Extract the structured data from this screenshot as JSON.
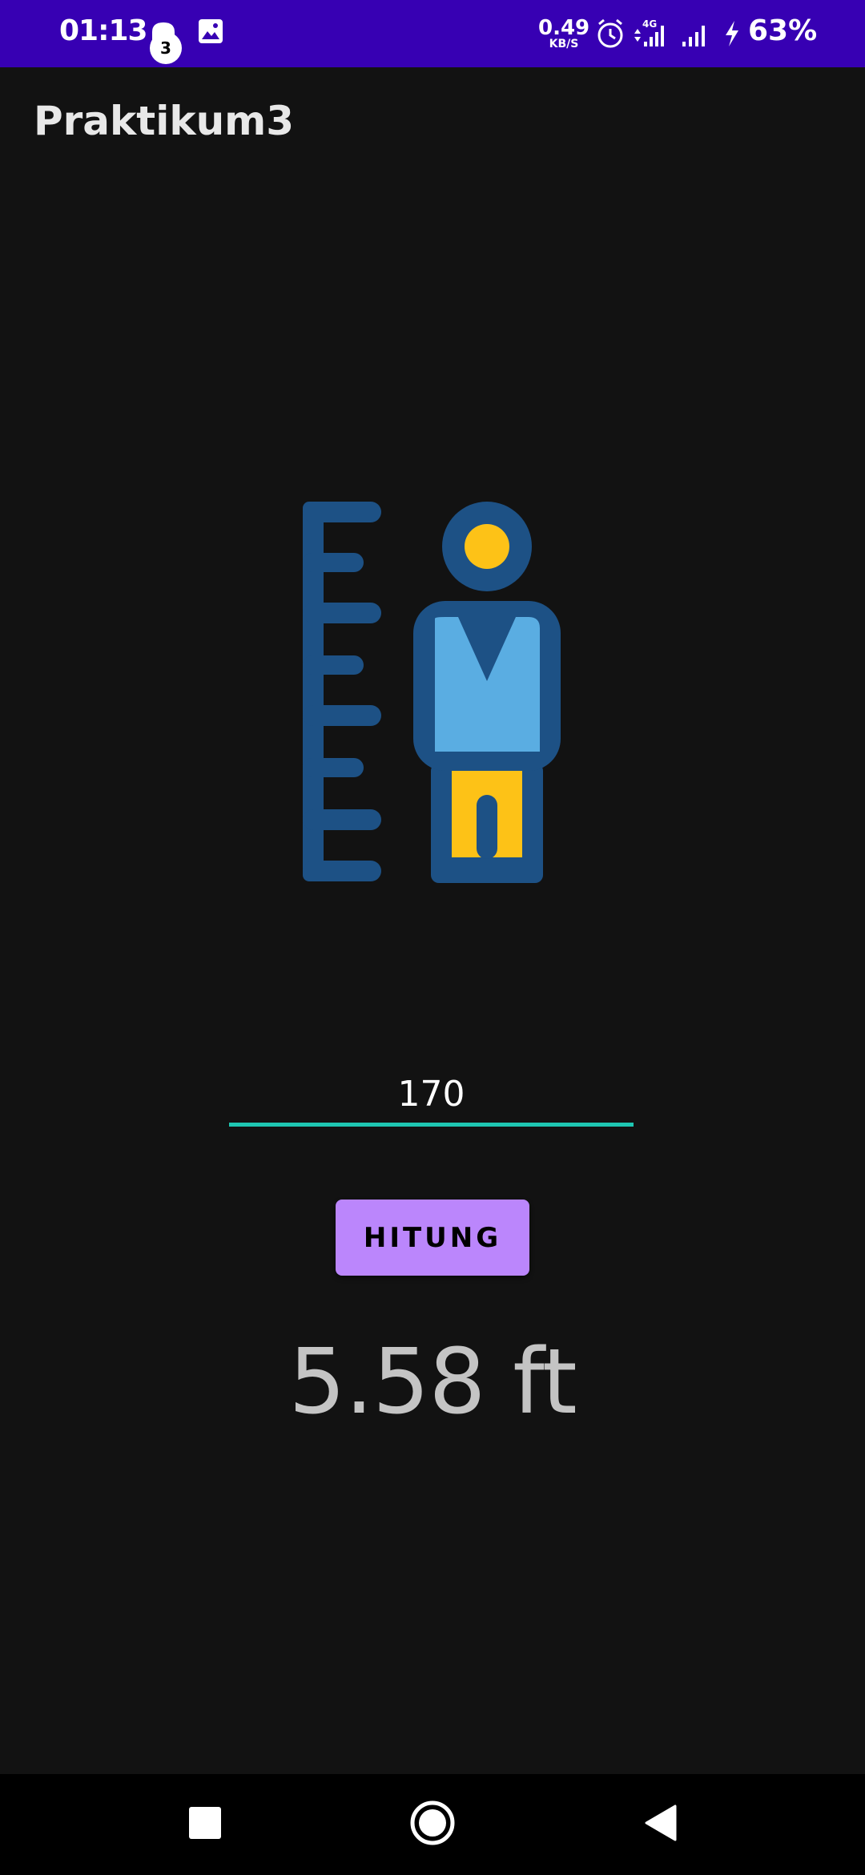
{
  "status_bar": {
    "time": "01:13",
    "notification_count": "3",
    "net_speed_value": "0.49",
    "net_speed_unit": "KB/S",
    "battery": "63%",
    "background_color": "#3700b3"
  },
  "app_bar": {
    "title": "Praktikum3"
  },
  "illustration": {
    "icon": "height-measure-person-icon",
    "colors": {
      "outline": "#1d5185",
      "head": "#fdc217",
      "body": "#5aade2",
      "legs": "#fdc217"
    }
  },
  "form": {
    "height_value": "170",
    "underline_color": "#1ec6b2",
    "button_label": "HITUNG",
    "button_color": "#bb86fc"
  },
  "result": {
    "text": "5.58 ft"
  },
  "nav_bar": {
    "items": [
      "recents-button",
      "home-button",
      "back-button"
    ]
  }
}
